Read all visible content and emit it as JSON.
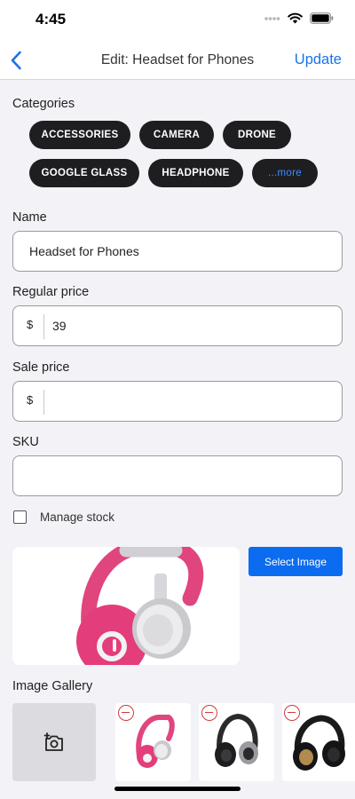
{
  "status_bar": {
    "time": "4:45",
    "icons": [
      "cellular-dots-icon",
      "wifi-icon",
      "battery-icon"
    ]
  },
  "nav": {
    "back_icon": "chevron-left-icon",
    "title": "Edit: Headset for Phones",
    "action_label": "Update"
  },
  "categories": {
    "label": "Categories",
    "chips": [
      "ACCESSORIES",
      "CAMERA",
      "DRONE",
      "GOOGLE GLASS",
      "HEADPHONE",
      "...more"
    ]
  },
  "form": {
    "name_label": "Name",
    "name_value": "Headset for Phones",
    "regular_price_label": "Regular price",
    "regular_price_currency": "$",
    "regular_price_value": "39",
    "sale_price_label": "Sale price",
    "sale_price_currency": "$",
    "sale_price_value": "",
    "sku_label": "SKU",
    "sku_value": "",
    "manage_stock_label": "Manage stock",
    "manage_stock_checked": false
  },
  "image": {
    "select_button_label": "Select Image"
  },
  "gallery": {
    "label": "Image Gallery",
    "add_icon": "add-photo-icon",
    "items": [
      {
        "kind": "pink-headphones",
        "remove_icon": "remove-circle-icon"
      },
      {
        "kind": "black-silver-headphones",
        "remove_icon": "remove-circle-icon"
      },
      {
        "kind": "black-gold-headphones",
        "remove_icon": "remove-circle-icon"
      }
    ]
  },
  "colors": {
    "accent": "#1a73e8",
    "chip_bg": "#1e1e20",
    "more_text": "#3d8dff",
    "danger": "#d23b3b",
    "button_bg": "#0b6cf0"
  }
}
